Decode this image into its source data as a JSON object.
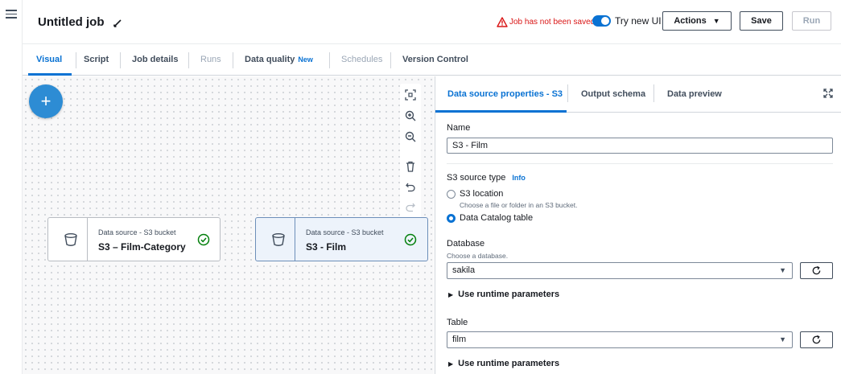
{
  "header": {
    "job_title": "Untitled job",
    "warning_text": "Job has not been saved",
    "toggle_label": "Try new UI",
    "actions_label": "Actions",
    "save_label": "Save",
    "run_label": "Run"
  },
  "tabs": [
    {
      "label": "Visual",
      "state": "active"
    },
    {
      "label": "Script",
      "state": "enabled"
    },
    {
      "label": "Job details",
      "state": "enabled"
    },
    {
      "label": "Runs",
      "state": "disabled"
    },
    {
      "label": "Data quality",
      "state": "enabled",
      "badge": "New"
    },
    {
      "label": "Schedules",
      "state": "disabled"
    },
    {
      "label": "Version Control",
      "state": "enabled"
    }
  ],
  "canvas": {
    "nodes": [
      {
        "type": "Data source - S3 bucket",
        "name": "S3 – Film-Category",
        "selected": false
      },
      {
        "type": "Data source - S3 bucket",
        "name": "S3 - Film",
        "selected": true
      }
    ]
  },
  "panel": {
    "tabs": [
      {
        "label": "Data source properties - S3",
        "active": true
      },
      {
        "label": "Output schema",
        "active": false
      },
      {
        "label": "Data preview",
        "active": false
      }
    ],
    "name_label": "Name",
    "name_value": "S3 - Film",
    "source_type_label": "S3 source type",
    "info_link": "Info",
    "radio_s3_location": "S3 location",
    "radio_s3_location_desc": "Choose a file or folder in an S3 bucket.",
    "radio_catalog": "Data Catalog table",
    "database_label": "Database",
    "database_desc": "Choose a database.",
    "database_value": "sakila",
    "runtime_params_1": "Use runtime parameters",
    "table_label": "Table",
    "table_value": "film",
    "runtime_params_2": "Use runtime parameters"
  },
  "colors": {
    "accent": "#0972d3",
    "warning": "#d91515",
    "success": "#037f0c"
  }
}
